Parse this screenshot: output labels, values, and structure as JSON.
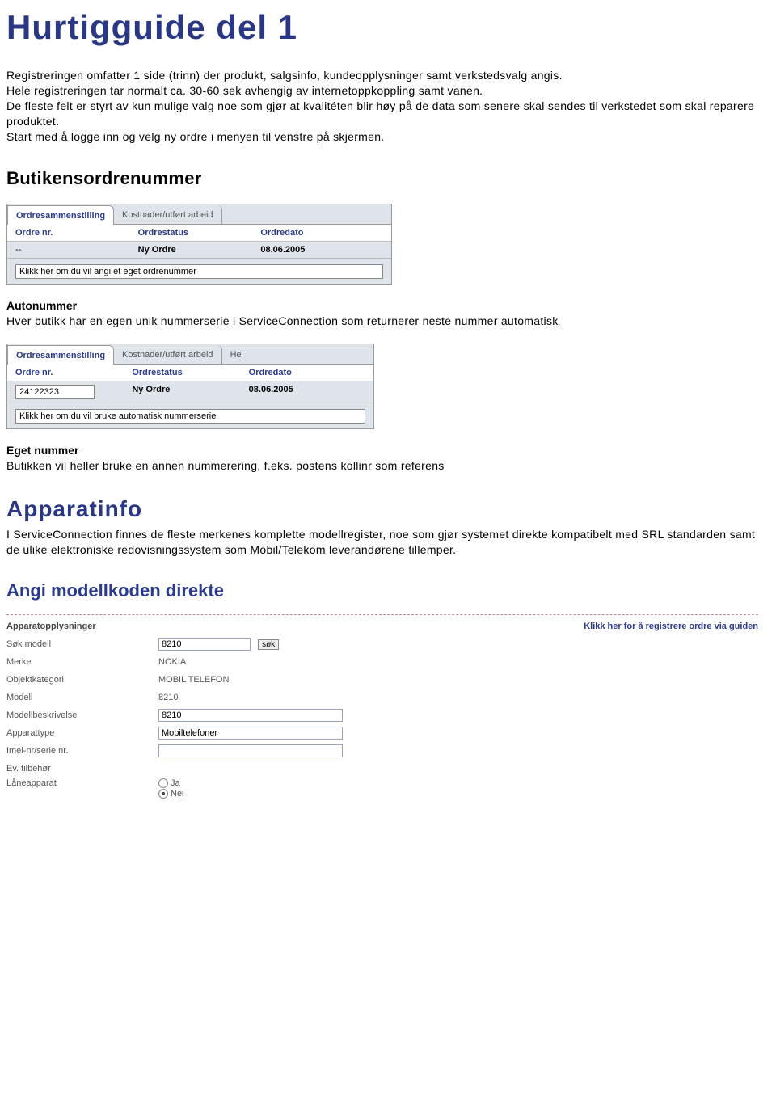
{
  "title": "Hurtigguide del 1",
  "intro": {
    "p1": "Registreringen omfatter 1 side (trinn) der produkt, salgsinfo, kundeopplysninger samt verkstedsvalg angis.",
    "p2": "Hele registreringen tar normalt ca. 30-60 sek avhengig av internetoppkoppling samt vanen.",
    "p3": "De fleste felt er styrt av kun mulige valg noe som gjør at kvalitéten blir høy på de data som senere skal sendes til verkstedet som skal reparere produktet.",
    "p4": "Start med å logge inn og velg ny ordre i menyen til venstre på skjermen."
  },
  "section_butikkens": "Butikensordrenummer",
  "panel1": {
    "tab_active": "Ordresammenstilling",
    "tab_inactive": "Kostnader/utført arbeid",
    "cols": {
      "c1": "Ordre nr.",
      "c2": "Ordrestatus",
      "c3": "Ordredato"
    },
    "row": {
      "c1": "--",
      "c2": "Ny Ordre",
      "c3": "08.06.2005"
    },
    "input_value": "Klikk her om du vil angi et eget ordrenummer"
  },
  "autonummer": {
    "heading": "Autonummer",
    "text": "Hver butikk har en egen unik nummerserie i ServiceConnection som returnerer neste nummer automatisk"
  },
  "panel2": {
    "tab_active": "Ordresammenstilling",
    "tab_inactive": "Kostnader/utført arbeid",
    "tab_cut": "He",
    "cols": {
      "c1": "Ordre nr.",
      "c2": "Ordrestatus",
      "c3": "Ordredato"
    },
    "row": {
      "c1_value": "24122323",
      "c2": "Ny Ordre",
      "c3": "08.06.2005"
    },
    "input_value": "Klikk her om du vil bruke automatisk nummerserie"
  },
  "egetnummer": {
    "heading": "Eget nummer",
    "text": "Butikken vil heller bruke en annen nummerering, f.eks. postens kollinr som referens"
  },
  "apparatinfo": {
    "heading": "Apparatinfo",
    "text": "I ServiceConnection finnes de fleste merkenes komplette modellregister, noe som gjør systemet direkte kompatibelt med SRL standarden samt de ulike elektroniske redovisningssystem som Mobil/Telekom leverandørene tillemper."
  },
  "angi_heading": "Angi modellkoden direkte",
  "form": {
    "top_left": "Apparatopplysninger",
    "top_right": "Klikk her for å registrere ordre via guiden",
    "sok_modell_label": "Søk modell",
    "sok_modell_value": "8210",
    "sok_button": "søk",
    "merke_label": "Merke",
    "merke_value": "NOKIA",
    "objektkategori_label": "Objektkategori",
    "objektkategori_value": "MOBIL TELEFON",
    "modell_label": "Modell",
    "modell_value": "8210",
    "modellbeskrivelse_label": "Modellbeskrivelse",
    "modellbeskrivelse_value": "8210",
    "apparattype_label": "Apparattype",
    "apparattype_value": "Mobiltelefoner",
    "imei_label": "Imei-nr/serie nr.",
    "imei_value": "",
    "ev_tilbehor_label": "Ev. tilbehør",
    "laneapparat_label": "Låneapparat",
    "radio_ja": "Ja",
    "radio_nei": "Nei"
  }
}
